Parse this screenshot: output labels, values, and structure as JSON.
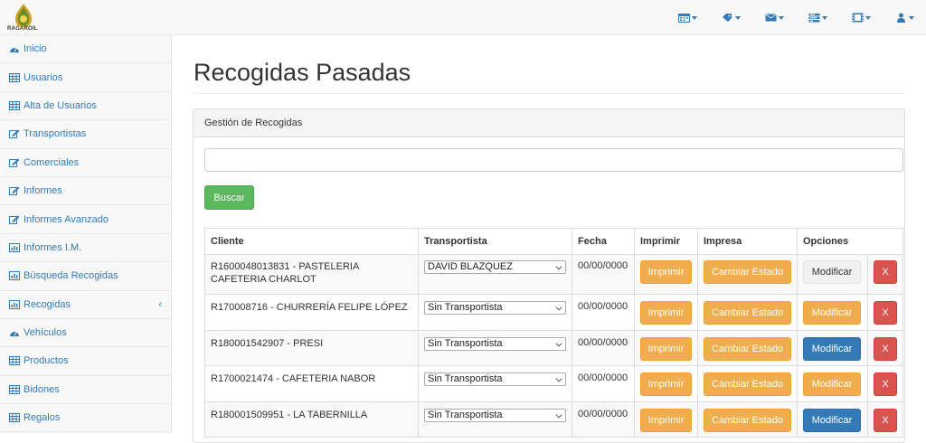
{
  "header": {
    "logo_text": "RAGAROIL",
    "nav_icons": [
      "calendar-icon",
      "tags-icon",
      "envelope-icon",
      "tasks-icon",
      "film-icon",
      "user-icon"
    ]
  },
  "sidebar": {
    "items": [
      {
        "label": "Inicio",
        "icon": "dashboard-icon"
      },
      {
        "label": "Usuarios",
        "icon": "table-icon"
      },
      {
        "label": "Alta de Usuarios",
        "icon": "table-icon"
      },
      {
        "label": "Transportistas",
        "icon": "edit-icon"
      },
      {
        "label": "Comerciales",
        "icon": "edit-icon"
      },
      {
        "label": "Informes",
        "icon": "edit-icon"
      },
      {
        "label": "Informes Avanzado",
        "icon": "edit-icon"
      },
      {
        "label": "Informes I.M.",
        "icon": "bar-chart-icon"
      },
      {
        "label": "Búsqueda Recogidas",
        "icon": "bar-chart-icon"
      },
      {
        "label": "Recogidas",
        "icon": "bar-chart-icon",
        "chevron": "‹"
      },
      {
        "label": "Vehículos",
        "icon": "dashboard-icon"
      },
      {
        "label": "Productos",
        "icon": "table-icon"
      },
      {
        "label": "Bidones",
        "icon": "table-icon"
      },
      {
        "label": "Regalos",
        "icon": "table-icon"
      }
    ]
  },
  "main": {
    "title": "Recogidas Pasadas",
    "panel_heading": "Gestión de Recogidas",
    "search": {
      "value": "",
      "placeholder": ""
    },
    "search_button": "Buscar",
    "table": {
      "headers": [
        "Cliente",
        "Transportista",
        "Fecha",
        "Imprimir",
        "Impresa",
        "Opciones"
      ],
      "rows": [
        {
          "cliente": "R1600048013831 - PASTELERIA CAFETERIA CHARLOT",
          "transportista": "DAVID BLAZQUEZ",
          "fecha": "00/00/0000",
          "imprimir": "Imprimir",
          "impresa": "Cambiar Estado",
          "modificar": "Modificar",
          "modificar_style": "default",
          "delete": "X"
        },
        {
          "cliente": "R170008716 - CHURRERÍA FELIPE LÓPEZ",
          "transportista": "Sin Transportista",
          "fecha": "00/00/0000",
          "imprimir": "Imprimir",
          "impresa": "Cambiar Estado",
          "modificar": "Modificar",
          "modificar_style": "warning",
          "delete": "X"
        },
        {
          "cliente": "R180001542907 - PRESI",
          "transportista": "Sin Transportista",
          "fecha": "00/00/0000",
          "imprimir": "Imprimir",
          "impresa": "Cambiar Estado",
          "modificar": "Modificar",
          "modificar_style": "primary",
          "delete": "X"
        },
        {
          "cliente": "R1700021474 - CAFETERIA NABOR",
          "transportista": "Sin Transportista",
          "fecha": "00/00/0000",
          "imprimir": "Imprimir",
          "impresa": "Cambiar Estado",
          "modificar": "Modificar",
          "modificar_style": "warning",
          "delete": "X"
        },
        {
          "cliente": "R180001509951 - LA TABERNILLA",
          "transportista": "Sin Transportista",
          "fecha": "00/00/0000",
          "imprimir": "Imprimir",
          "impresa": "Cambiar Estado",
          "modificar": "Modificar",
          "modificar_style": "primary",
          "delete": "X"
        }
      ]
    }
  },
  "colors": {
    "link": "#337ab7",
    "success": "#5cb85c",
    "warning": "#f0ad4e",
    "primary": "#337ab7",
    "danger": "#d9534f"
  }
}
